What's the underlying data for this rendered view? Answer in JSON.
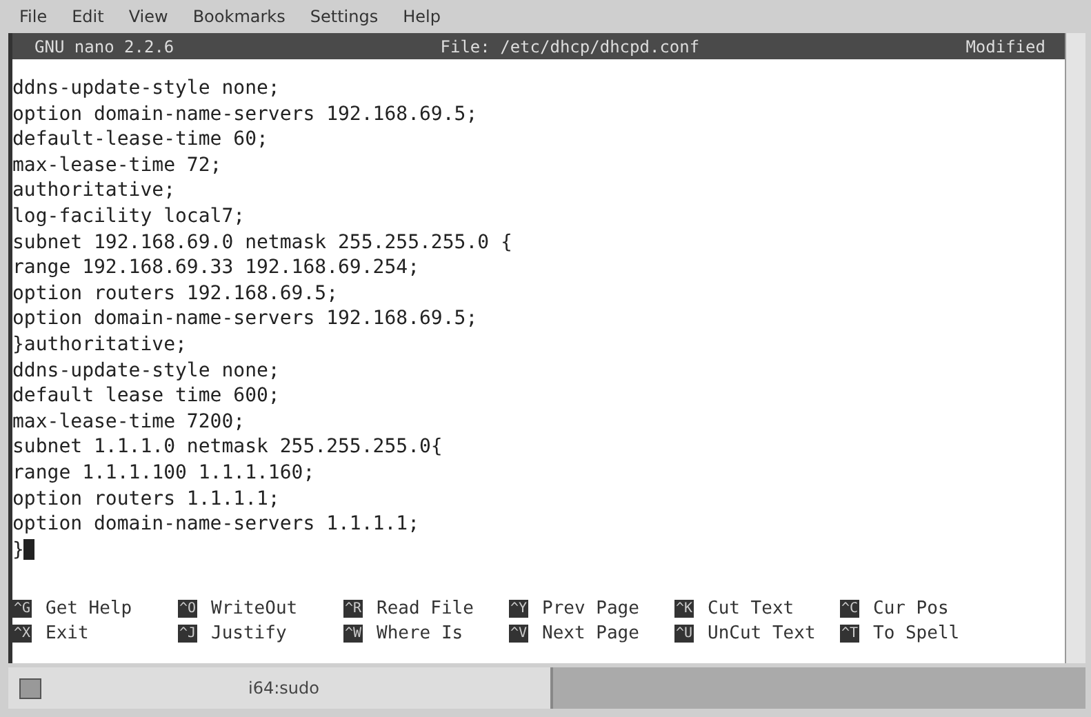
{
  "menu": [
    "File",
    "Edit",
    "View",
    "Bookmarks",
    "Settings",
    "Help"
  ],
  "title_bar": {
    "version": "GNU nano 2.2.6",
    "file": "File: /etc/dhcp/dhcpd.conf",
    "status": "Modified"
  },
  "lines": [
    "ddns-update-style none;",
    "option domain-name-servers 192.168.69.5;",
    "default-lease-time 60;",
    "max-lease-time 72;",
    "authoritative;",
    "log-facility local7;",
    "subnet 192.168.69.0 netmask 255.255.255.0 {",
    "range 192.168.69.33 192.168.69.254;",
    "option routers 192.168.69.5;",
    "option domain-name-servers 192.168.69.5;",
    "}authoritative;",
    "ddns-update-style none;",
    "default lease time 600;",
    "max-lease-time 7200;",
    "subnet 1.1.1.0 netmask 255.255.255.0{",
    "range 1.1.1.100 1.1.1.160;",
    "option routers 1.1.1.1;",
    "option domain-name-servers 1.1.1.1;",
    "}"
  ],
  "shortcuts": [
    [
      {
        "key": "^G",
        "label": "Get Help"
      },
      {
        "key": "^X",
        "label": "Exit"
      }
    ],
    [
      {
        "key": "^O",
        "label": "WriteOut"
      },
      {
        "key": "^J",
        "label": "Justify"
      }
    ],
    [
      {
        "key": "^R",
        "label": "Read File"
      },
      {
        "key": "^W",
        "label": "Where Is"
      }
    ],
    [
      {
        "key": "^Y",
        "label": "Prev Page"
      },
      {
        "key": "^V",
        "label": "Next Page"
      }
    ],
    [
      {
        "key": "^K",
        "label": "Cut Text"
      },
      {
        "key": "^U",
        "label": "UnCut Text"
      }
    ],
    [
      {
        "key": "^C",
        "label": "Cur Pos"
      },
      {
        "key": "^T",
        "label": "To Spell"
      }
    ]
  ],
  "taskbar": {
    "tab": "i64:sudo"
  }
}
